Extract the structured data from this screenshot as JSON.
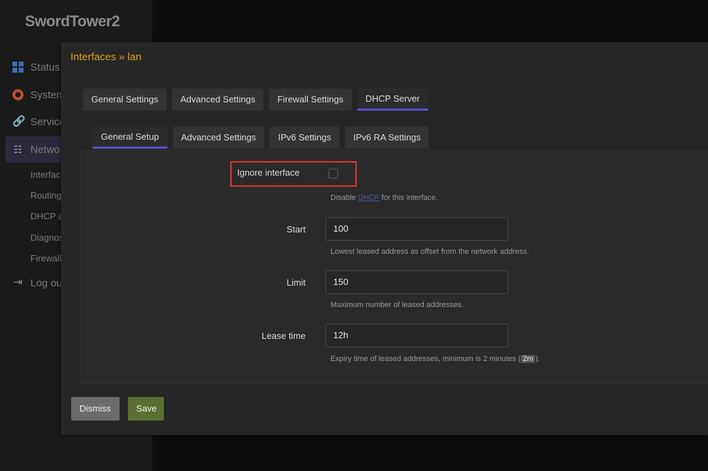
{
  "brand": "SwordTower2",
  "sidebar": {
    "items": [
      {
        "label": "Status",
        "icon": "grid-icon"
      },
      {
        "label": "System",
        "icon": "gear-icon"
      },
      {
        "label": "Service",
        "icon": "link-icon"
      },
      {
        "label": "Netwo",
        "icon": "network-icon"
      }
    ],
    "subitems": [
      "Interfac",
      "Routing",
      "DHCP a",
      "Diagnos",
      "Firewall"
    ],
    "logout": "Log ou"
  },
  "modal": {
    "title": "Interfaces » lan",
    "tabs": [
      "General Settings",
      "Advanced Settings",
      "Firewall Settings",
      "DHCP Server"
    ],
    "active_tab": "DHCP Server",
    "subtabs": [
      "General Setup",
      "Advanced Settings",
      "IPv6 Settings",
      "IPv6 RA Settings"
    ],
    "active_subtab": "General Setup",
    "fields": {
      "ignore": {
        "label": "Ignore interface",
        "checked": false,
        "hint_pre": "Disable ",
        "hint_link": "DHCP",
        "hint_post": " for this interface."
      },
      "start": {
        "label": "Start",
        "value": "100",
        "hint": "Lowest leased address as offset from the network address."
      },
      "limit": {
        "label": "Limit",
        "value": "150",
        "hint": "Maximum number of leased addresses."
      },
      "leasetime": {
        "label": "Lease time",
        "value": "12h",
        "hint_pre": "Expiry time of leased addresses, minimum is 2 minutes (",
        "hint_code": "2m",
        "hint_post": ")."
      }
    },
    "buttons": {
      "dismiss": "Dismiss",
      "save": "Save"
    }
  },
  "colors": {
    "accent": "#e0a411",
    "tab_active": "#5b4fd0",
    "highlight": "#e23333",
    "save": "#5a7030"
  }
}
